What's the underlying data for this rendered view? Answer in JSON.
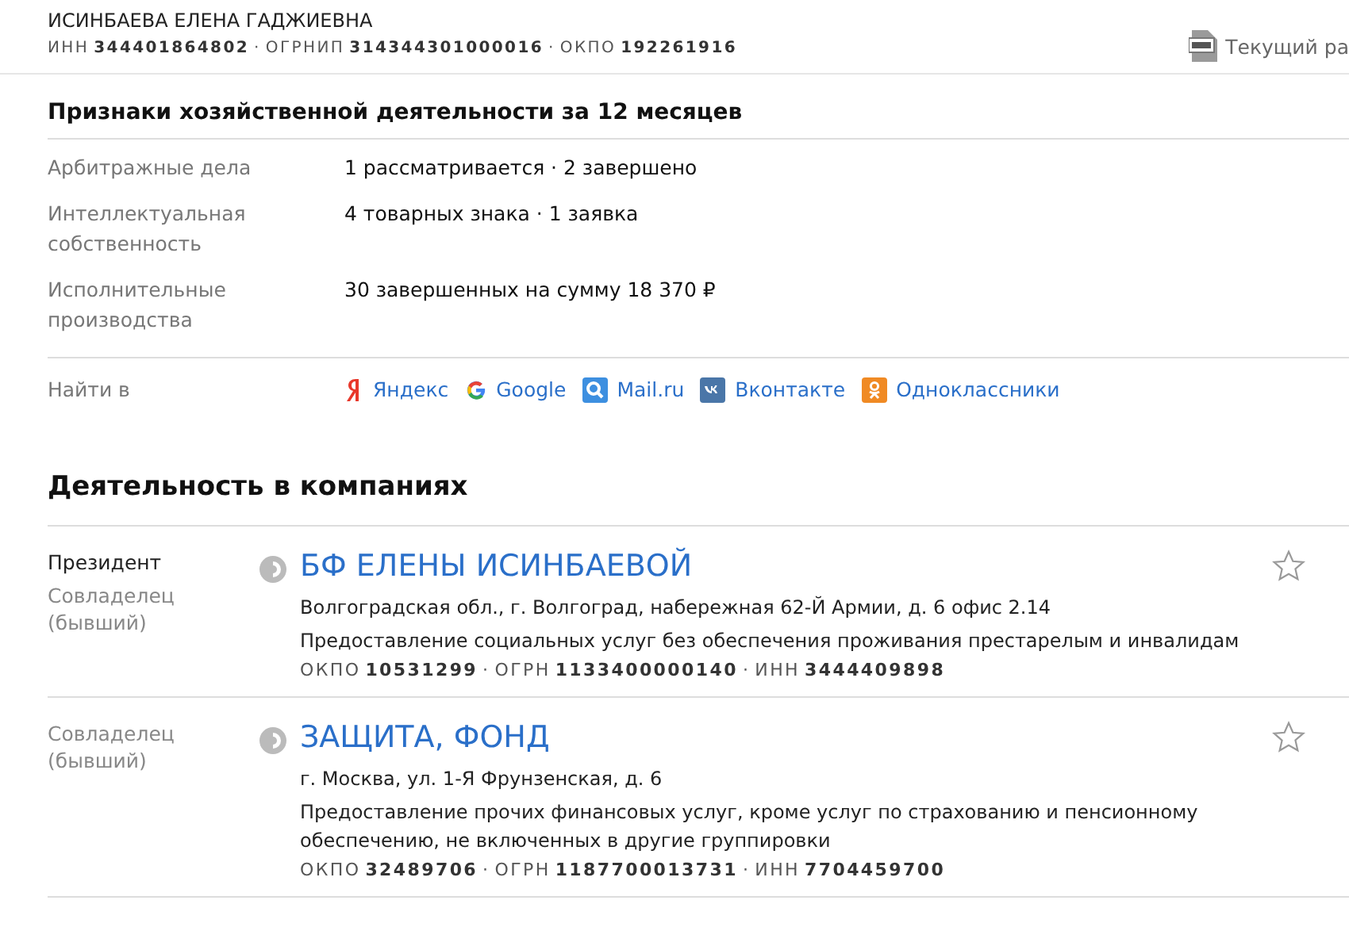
{
  "separator": "·",
  "person": {
    "name": "ИСИНБАЕВА ЕЛЕНА ГАДЖИЕВНА",
    "codes": [
      {
        "label": "ИНН",
        "value": "344401864802"
      },
      {
        "label": "ОГРНИП",
        "value": "314344301000016"
      },
      {
        "label": "ОКПО",
        "value": "192261916"
      }
    ],
    "doc_link": "Текущий ра"
  },
  "activity": {
    "title": "Признаки хозяйственной деятельности за 12 месяцев",
    "rows": [
      {
        "label": "Арбитражные дела",
        "value": "1 рассматривается · 2 завершено"
      },
      {
        "label": "Интеллектуальная собственность",
        "value": "4 товарных знака · 1 заявка"
      },
      {
        "label": "Исполнительные производства",
        "value": "30 завершенных на сумму 18 370 ₽"
      }
    ]
  },
  "find": {
    "label": "Найти в",
    "links": [
      {
        "kind": "yandex",
        "text": "Яндекс"
      },
      {
        "kind": "google",
        "text": "Google"
      },
      {
        "kind": "mail",
        "text": "Mail.ru"
      },
      {
        "kind": "vk",
        "text": "Вконтакте"
      },
      {
        "kind": "ok",
        "text": "Одноклассники"
      }
    ]
  },
  "companies": {
    "title": "Деятельность в компаниях",
    "items": [
      {
        "roles": [
          {
            "kind": "current",
            "text": "Президент"
          },
          {
            "kind": "former",
            "text": "Совладелец (бывший)"
          }
        ],
        "name": "БФ ЕЛЕНЫ ИСИНБАЕВОЙ",
        "address": "Волгоградская обл., г. Волгоград, набережная 62-Й Армии, д. 6 офис 2.14",
        "activity": "Предоставление социальных услуг без обеспечения проживания престарелым и инвалидам",
        "codes": [
          {
            "label": "ОКПО",
            "value": "10531299"
          },
          {
            "label": "ОГРН",
            "value": "1133400000140"
          },
          {
            "label": "ИНН",
            "value": "3444409898"
          }
        ],
        "starred": false
      },
      {
        "roles": [
          {
            "kind": "former",
            "text": "Совладелец (бывший)"
          }
        ],
        "name": "ЗАЩИТА, ФОНД",
        "address": "г. Москва, ул. 1-Я Фрунзенская, д. 6",
        "activity": "Предоставление прочих финансовых услуг, кроме услуг по страхованию и пенсионному обеспечению, не включенных в другие группировки",
        "codes": [
          {
            "label": "ОКПО",
            "value": "32489706"
          },
          {
            "label": "ОГРН",
            "value": "1187700013731"
          },
          {
            "label": "ИНН",
            "value": "7704459700"
          }
        ],
        "starred": false
      }
    ]
  }
}
